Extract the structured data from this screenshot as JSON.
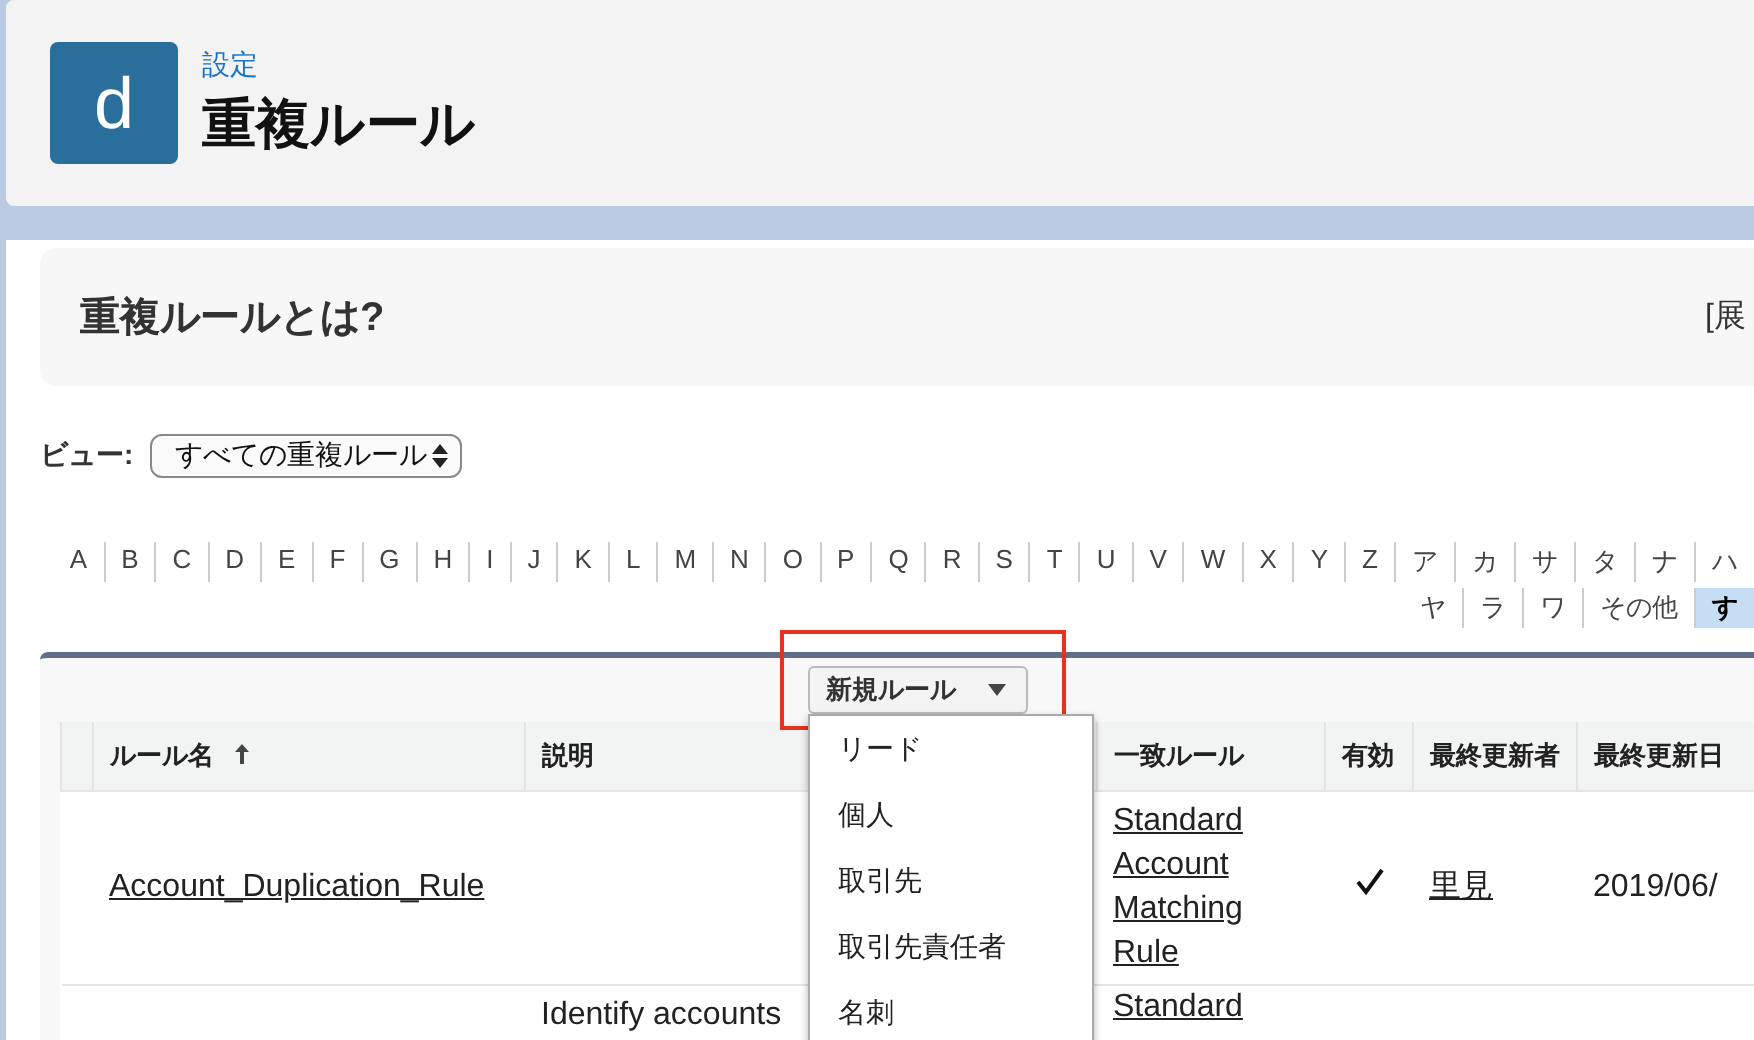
{
  "header": {
    "icon_letter": "d",
    "breadcrumb": "設定",
    "title": "重複ルール"
  },
  "info_panel": {
    "title": "重複ルールとは?",
    "link": "[展"
  },
  "view": {
    "label": "ビュー:",
    "value": "すべての重複ルール"
  },
  "alphabet": {
    "row_1": [
      {
        "label": "A",
        "selected": false
      },
      {
        "label": "B",
        "selected": false
      },
      {
        "label": "C",
        "selected": false
      },
      {
        "label": "D",
        "selected": false
      },
      {
        "label": "E",
        "selected": false
      },
      {
        "label": "F",
        "selected": false
      },
      {
        "label": "G",
        "selected": false
      },
      {
        "label": "H",
        "selected": false
      },
      {
        "label": "I",
        "selected": false
      },
      {
        "label": "J",
        "selected": false
      },
      {
        "label": "K",
        "selected": false
      },
      {
        "label": "L",
        "selected": false
      },
      {
        "label": "M",
        "selected": false
      },
      {
        "label": "N",
        "selected": false
      },
      {
        "label": "O",
        "selected": false
      },
      {
        "label": "P",
        "selected": false
      },
      {
        "label": "Q",
        "selected": false
      },
      {
        "label": "R",
        "selected": false
      },
      {
        "label": "S",
        "selected": false
      },
      {
        "label": "T",
        "selected": false
      },
      {
        "label": "U",
        "selected": false
      },
      {
        "label": "V",
        "selected": false
      },
      {
        "label": "W",
        "selected": false
      },
      {
        "label": "X",
        "selected": false
      },
      {
        "label": "Y",
        "selected": false
      },
      {
        "label": "Z",
        "selected": false
      },
      {
        "label": "ア",
        "selected": false
      },
      {
        "label": "カ",
        "selected": false
      },
      {
        "label": "サ",
        "selected": false
      },
      {
        "label": "タ",
        "selected": false
      },
      {
        "label": "ナ",
        "selected": false
      },
      {
        "label": "ハ",
        "selected": false
      }
    ],
    "row_2": [
      {
        "label": "ヤ",
        "selected": false
      },
      {
        "label": "ラ",
        "selected": false
      },
      {
        "label": "ワ",
        "selected": false
      },
      {
        "label": "その他",
        "selected": false
      },
      {
        "label": "す",
        "selected": true
      }
    ]
  },
  "new_rule_button": {
    "label": "新規ルール",
    "highlighted": true
  },
  "new_rule_menu": {
    "expanded": true,
    "items": [
      "リード",
      "個人",
      "取引先",
      "取引先責任者",
      "名刺"
    ]
  },
  "table": {
    "columns": [
      {
        "label": "ルール名",
        "sorted_ascending": true
      },
      {
        "label": "説明",
        "sorted_ascending": false
      },
      {
        "label": "一致ルール",
        "sorted_ascending": false
      },
      {
        "label": "有効",
        "sorted_ascending": false
      },
      {
        "label": "最終更新者",
        "sorted_ascending": false
      },
      {
        "label": "最終更新日",
        "sorted_ascending": false
      }
    ],
    "rows": [
      {
        "rule_name": "Account_Duplication_Rule",
        "matching_rule": "Standard Account Matching Rule",
        "active": true,
        "modified_by": "里見",
        "modified_date": "2019/06/"
      },
      {
        "description": "Identify accounts",
        "matching_rule": "Standard"
      }
    ]
  }
}
